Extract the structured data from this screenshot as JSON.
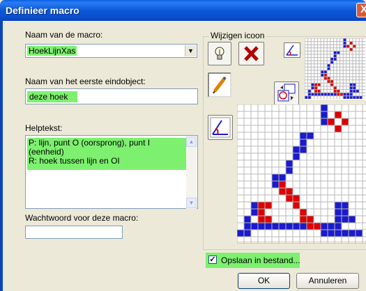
{
  "window": {
    "title": "Definieer macro",
    "close_glyph": "X"
  },
  "macro_name": {
    "label": "Naam van de macro:",
    "value": "HoekLijnXas",
    "dropdown_glyph": "▼"
  },
  "first_object": {
    "label": "Naam van het eerste eindobject:",
    "value": "deze hoek"
  },
  "help": {
    "label": "Helptekst:",
    "lines": [
      "P: lijn, punt O (oorsprong), punt I",
      "(eenheid)",
      "R: hoek tussen lijn en OI"
    ]
  },
  "password": {
    "label": "Wachtwoord voor deze macro:",
    "value": ""
  },
  "icon_group": {
    "label": "Wijzigen icoon"
  },
  "save_option": {
    "label": "Opslaan in bestand...",
    "checked": true,
    "check_glyph": "✓"
  },
  "buttons": {
    "ok": "OK",
    "cancel": "Annuleren"
  },
  "colors": {
    "accent_highlight": "#7ef070",
    "pixel_blue": "#1a1acc",
    "pixel_red": "#dd0000"
  },
  "icon_pixels": {
    "blue": [
      [
        12,
        0
      ],
      [
        12,
        1
      ],
      [
        12,
        2
      ],
      [
        9,
        4
      ],
      [
        10,
        4
      ],
      [
        9,
        5
      ],
      [
        9,
        6
      ],
      [
        8,
        6
      ],
      [
        8,
        7
      ],
      [
        7,
        8
      ],
      [
        7,
        9
      ],
      [
        5,
        10
      ],
      [
        6,
        10
      ],
      [
        5,
        11
      ],
      [
        2,
        14
      ],
      [
        2,
        15
      ],
      [
        1,
        16
      ],
      [
        1,
        17
      ],
      [
        2,
        17
      ],
      [
        3,
        17
      ],
      [
        4,
        17
      ],
      [
        5,
        17
      ],
      [
        6,
        17
      ],
      [
        7,
        17
      ],
      [
        8,
        17
      ],
      [
        9,
        17
      ],
      [
        10,
        17
      ],
      [
        11,
        17
      ],
      [
        12,
        17
      ],
      [
        13,
        17
      ],
      [
        14,
        17
      ],
      [
        0,
        18
      ],
      [
        1,
        18
      ],
      [
        12,
        18
      ],
      [
        13,
        18
      ],
      [
        14,
        18
      ],
      [
        15,
        18
      ],
      [
        16,
        18
      ],
      [
        17,
        18
      ],
      [
        14,
        14
      ],
      [
        15,
        14
      ],
      [
        14,
        15
      ],
      [
        15,
        15
      ],
      [
        15,
        16
      ],
      [
        16,
        16
      ],
      [
        14,
        16
      ]
    ],
    "red": [
      [
        14,
        1
      ],
      [
        15,
        2
      ],
      [
        13,
        2
      ],
      [
        14,
        3
      ],
      [
        6,
        12
      ],
      [
        7,
        12
      ],
      [
        7,
        13
      ],
      [
        8,
        13
      ],
      [
        8,
        14
      ],
      [
        9,
        15
      ],
      [
        9,
        16
      ],
      [
        10,
        16
      ],
      [
        10,
        17
      ],
      [
        11,
        17
      ],
      [
        3,
        14
      ],
      [
        3,
        15
      ],
      [
        3,
        16
      ],
      [
        4,
        16
      ],
      [
        4,
        14
      ],
      [
        6,
        11
      ]
    ]
  }
}
